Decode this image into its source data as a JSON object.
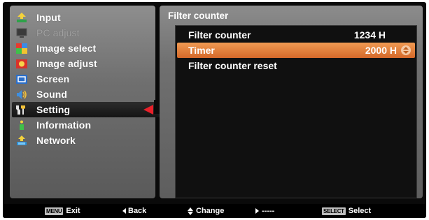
{
  "menu": {
    "items": [
      {
        "label": "Input",
        "icon": "input-icon",
        "state": "normal"
      },
      {
        "label": "PC adjust",
        "icon": "pc-adjust-icon",
        "state": "disabled"
      },
      {
        "label": "Image select",
        "icon": "image-select-icon",
        "state": "normal"
      },
      {
        "label": "Image adjust",
        "icon": "image-adjust-icon",
        "state": "normal"
      },
      {
        "label": "Screen",
        "icon": "screen-icon",
        "state": "normal"
      },
      {
        "label": "Sound",
        "icon": "sound-icon",
        "state": "normal"
      },
      {
        "label": "Setting",
        "icon": "setting-icon",
        "state": "selected"
      },
      {
        "label": "Information",
        "icon": "information-icon",
        "state": "normal"
      },
      {
        "label": "Network",
        "icon": "network-icon",
        "state": "normal"
      }
    ]
  },
  "panel": {
    "title": "Filter counter",
    "rows": [
      {
        "label": "Filter counter",
        "value": "1234 H"
      },
      {
        "label": "Timer",
        "value": "2000 H",
        "highlighted": true
      },
      {
        "label": "Filter counter reset",
        "value": ""
      }
    ]
  },
  "bottom_bar": {
    "menu_key": "MENU",
    "exit_label": "Exit",
    "back_label": "Back",
    "change_label": "Change",
    "next_label": "-----",
    "select_key": "SELECT",
    "select_label": "Select"
  },
  "colors": {
    "highlight": "#e07a35",
    "selection_arrow": "#e8202a",
    "panel_gray": "#7a7a7a"
  }
}
